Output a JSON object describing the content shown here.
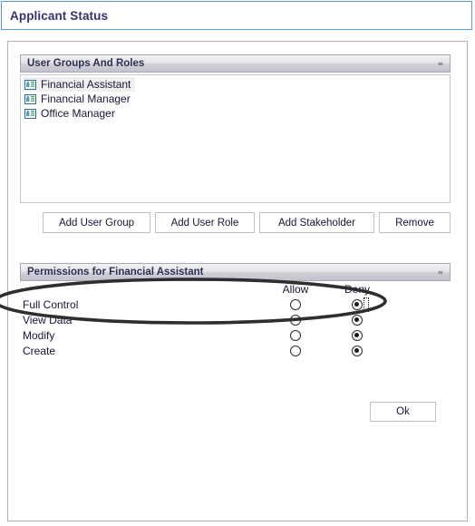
{
  "window": {
    "title": "Applicant Status",
    "title_color": "#31356e",
    "border_color": "#5b9bd5"
  },
  "sections": {
    "user_groups": {
      "title": "User Groups And Roles",
      "collapse_icon": "chevron-double-up-icon",
      "collapse_glyph": "«",
      "items": [
        {
          "label": "Financial Assistant",
          "icon": "contact-card-icon",
          "selected": true
        },
        {
          "label": "Financial Manager",
          "icon": "contact-card-icon",
          "selected": false
        },
        {
          "label": "Office Manager",
          "icon": "contact-card-icon",
          "selected": false
        }
      ]
    },
    "permissions": {
      "title": "Permissions for Financial Assistant",
      "collapse_icon": "chevron-double-up-icon",
      "collapse_glyph": "«",
      "columns": [
        "Allow",
        "Deny"
      ],
      "rows": [
        {
          "label": "Full Control",
          "allow": false,
          "deny": true,
          "focused": true
        },
        {
          "label": "View Data",
          "allow": false,
          "deny": true,
          "focused": false
        },
        {
          "label": "Modify",
          "allow": false,
          "deny": true,
          "focused": false
        },
        {
          "label": "Create",
          "allow": false,
          "deny": true,
          "focused": false
        }
      ]
    }
  },
  "buttons": {
    "add_user_group": "Add User Group",
    "add_user_role": "Add User Role",
    "add_stakeholder": "Add Stakeholder",
    "remove": "Remove",
    "ok": "Ok"
  },
  "annotation": {
    "shape": "ellipse-highlight",
    "color": "#2e2e2e",
    "target": "Full Control row / Deny radio"
  }
}
